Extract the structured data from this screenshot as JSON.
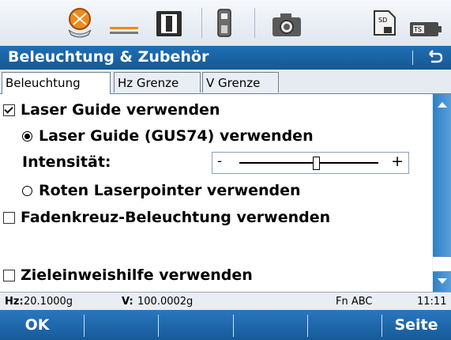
{
  "app": {
    "title": "Beleuchtung & Zubehör"
  },
  "top_icons": [
    "laser-target-icon",
    "laser-beam-icon",
    "reflector-icon",
    "battery-icon",
    "camera-icon",
    "sd-card-icon",
    "instrument-battery-icon"
  ],
  "tabs": [
    {
      "label": "Beleuchtung",
      "active": true
    },
    {
      "label": "Hz Grenze",
      "active": false
    },
    {
      "label": "V Grenze",
      "active": false
    }
  ],
  "options": {
    "laser_guide": {
      "label": "Laser Guide verwenden",
      "checked": true
    },
    "laser_guide_gus": {
      "label": "Laser Guide (GUS74) verwenden",
      "selected": true
    },
    "intensity": {
      "label": "Intensität:",
      "minus": "-",
      "plus": "+",
      "level": 0.55
    },
    "red_laser": {
      "label": "Roten Laserpointer verwenden",
      "selected": false
    },
    "reticle": {
      "label": "Fadenkreuz-Beleuchtung verwenden",
      "checked": false
    },
    "target_aid": {
      "label": "Zieleinweishilfe verwenden",
      "checked": false
    }
  },
  "status": {
    "hz_label": "Hz:",
    "hz_value": "20.1000g",
    "v_label": "V:",
    "v_value": "100.0002g",
    "mode": "Fn ABC",
    "time": "11:11"
  },
  "softkeys": {
    "ok": "OK",
    "page": "Seite"
  },
  "colors": {
    "accent": "#1a63a6",
    "scroll": "#3a8ad0"
  }
}
